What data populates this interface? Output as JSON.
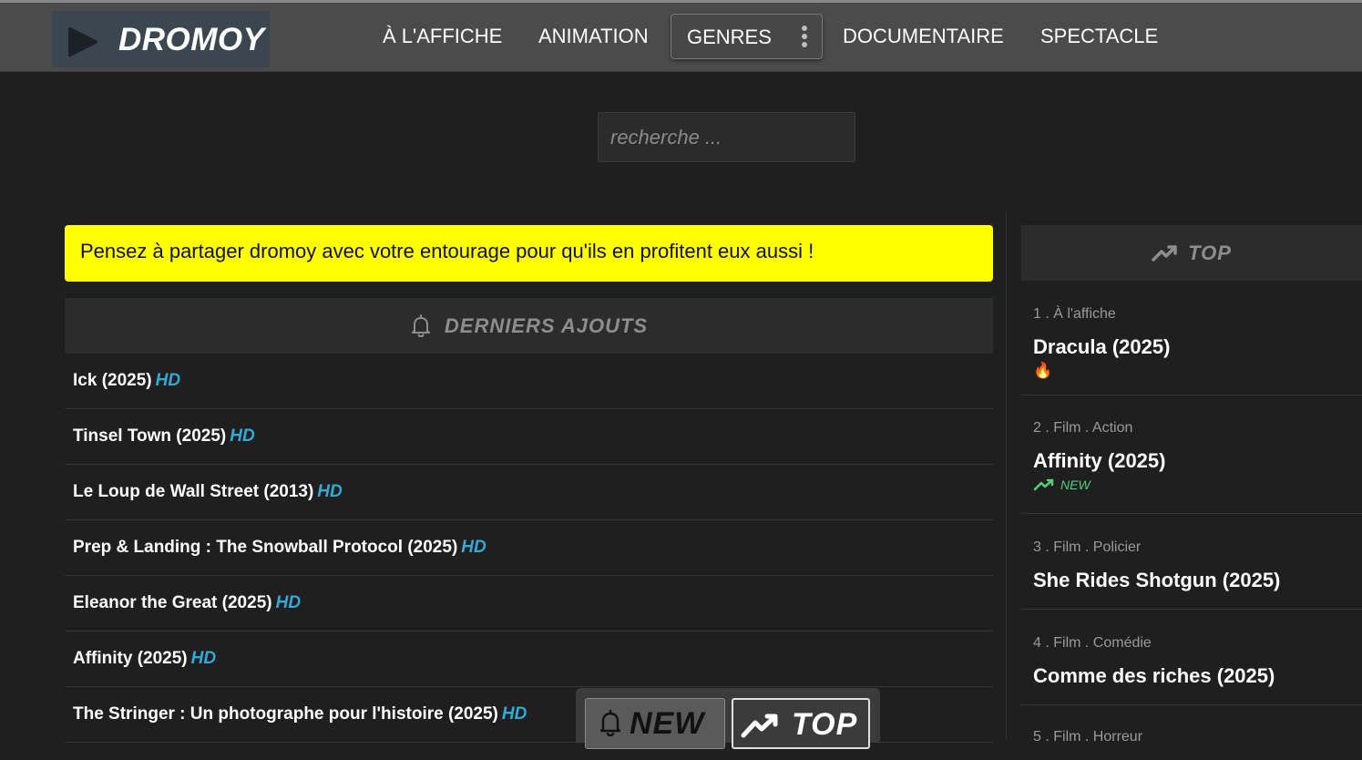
{
  "header": {
    "logo_text": "DROMOY",
    "nav": [
      {
        "label": "À L'AFFICHE"
      },
      {
        "label": "ANIMATION"
      },
      {
        "label": "GENRES"
      },
      {
        "label": "DOCUMENTAIRE"
      },
      {
        "label": "SPECTACLE"
      }
    ]
  },
  "search": {
    "placeholder": "recherche ..."
  },
  "notice": "Pensez à partager dromoy avec votre entourage pour qu'ils en profitent eux aussi !",
  "latest": {
    "heading": "DERNIERS AJOUTS",
    "items": [
      {
        "title": "Ick (2025)",
        "quality": "HD"
      },
      {
        "title": "Tinsel Town (2025)",
        "quality": "HD"
      },
      {
        "title": "Le Loup de Wall Street (2013)",
        "quality": "HD"
      },
      {
        "title": "Prep & Landing : The Snowball Protocol (2025)",
        "quality": "HD"
      },
      {
        "title": "Eleanor the Great (2025)",
        "quality": "HD"
      },
      {
        "title": "Affinity (2025)",
        "quality": "HD"
      },
      {
        "title": "The Stringer : Un photographe pour l'histoire (2025)",
        "quality": "HD"
      }
    ]
  },
  "top": {
    "heading": "TOP",
    "items": [
      {
        "category": "1 . À l'affiche",
        "title": "Dracula (2025)",
        "badge": "🔥"
      },
      {
        "category": "2 . Film . Action",
        "title": "Affinity (2025)",
        "badge": "NEW"
      },
      {
        "category": "3 . Film . Policier",
        "title": "She Rides Shotgun (2025)"
      },
      {
        "category": "4 . Film . Comédie",
        "title": "Comme des riches (2025)"
      },
      {
        "category": "5 . Film . Horreur",
        "title": ""
      }
    ]
  },
  "floating": {
    "new_label": "NEW",
    "top_label": "TOP"
  },
  "colors": {
    "accent_hd": "#33a9d6",
    "notice_bg": "#ffff00",
    "new_badge": "#4fd17a"
  }
}
